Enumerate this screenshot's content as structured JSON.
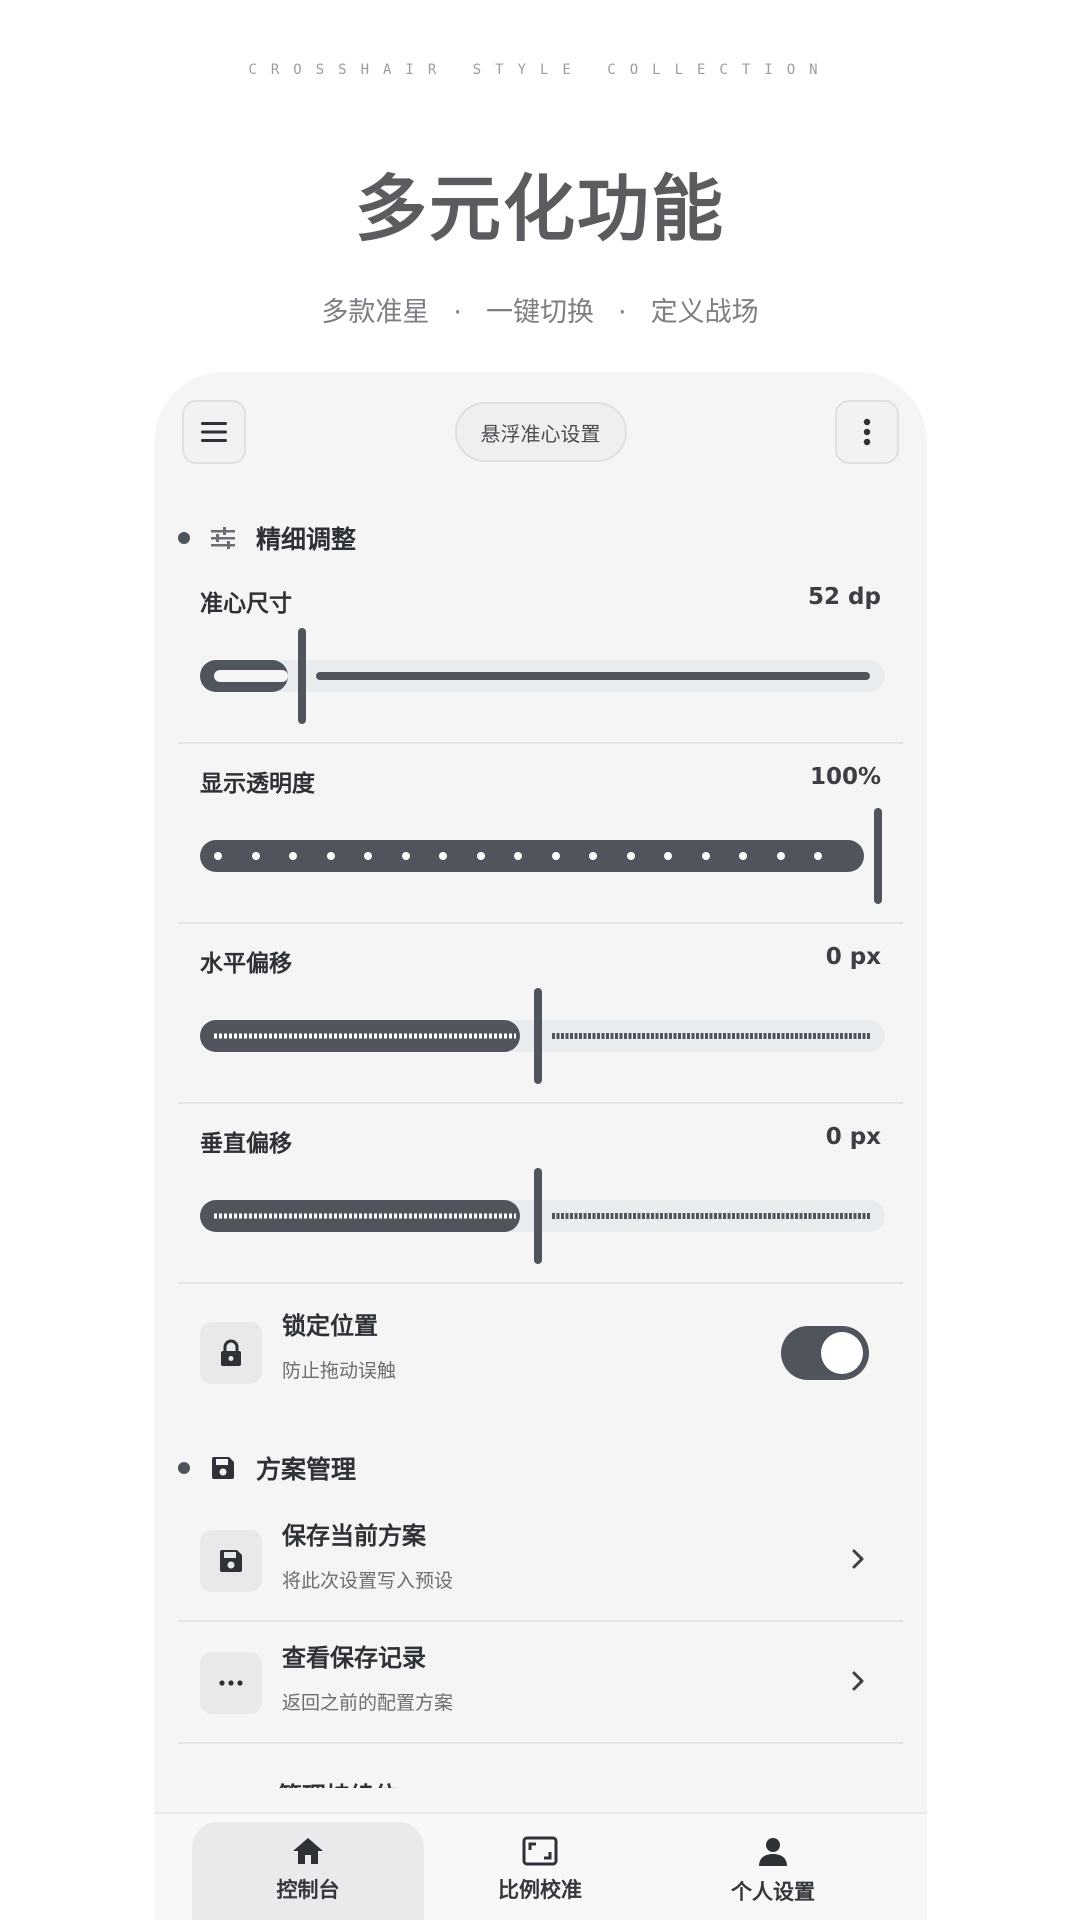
{
  "header": {
    "tagline": "CROSSHAIR STYLE COLLECTION",
    "title": "多元化功能",
    "features": [
      "多款准星",
      "一键切换",
      "定义战场"
    ]
  },
  "topbar": {
    "menu_icon": "menu-icon",
    "center_label": "悬浮准心设置",
    "more_icon": "more-vertical-icon"
  },
  "fine_tune": {
    "title": "精细调整",
    "icon": "tune-icon",
    "sliders": [
      {
        "label": "准心尺寸",
        "value": "52 dp",
        "fraction": 0.14
      },
      {
        "label": "显示透明度",
        "value": "100%",
        "fraction": 1.0
      },
      {
        "label": "水平偏移",
        "value": "0 px",
        "fraction": 0.5
      },
      {
        "label": "垂直偏移",
        "value": "0 px",
        "fraction": 0.5
      }
    ],
    "lock": {
      "title": "锁定位置",
      "subtitle": "防止拖动误触",
      "icon": "lock-icon",
      "enabled": true
    }
  },
  "profiles": {
    "title": "方案管理",
    "icon": "save-icon",
    "items": [
      {
        "title": "保存当前方案",
        "subtitle": "将此次设置写入预设",
        "icon": "save-icon"
      },
      {
        "title": "查看保存记录",
        "subtitle": "返回之前的配置方案",
        "icon": "more-horizontal-icon"
      },
      {
        "title": "管理持续位",
        "subtitle": "",
        "icon": ""
      }
    ]
  },
  "nav": {
    "items": [
      {
        "label": "控制台",
        "icon": "home-icon",
        "active": true
      },
      {
        "label": "比例校准",
        "icon": "aspect-ratio-icon",
        "active": false
      },
      {
        "label": "个人设置",
        "icon": "person-icon",
        "active": false
      }
    ]
  },
  "colors": {
    "accent": "#50555d",
    "track_light": "#e9ecef",
    "background": "#f5f5f5"
  }
}
